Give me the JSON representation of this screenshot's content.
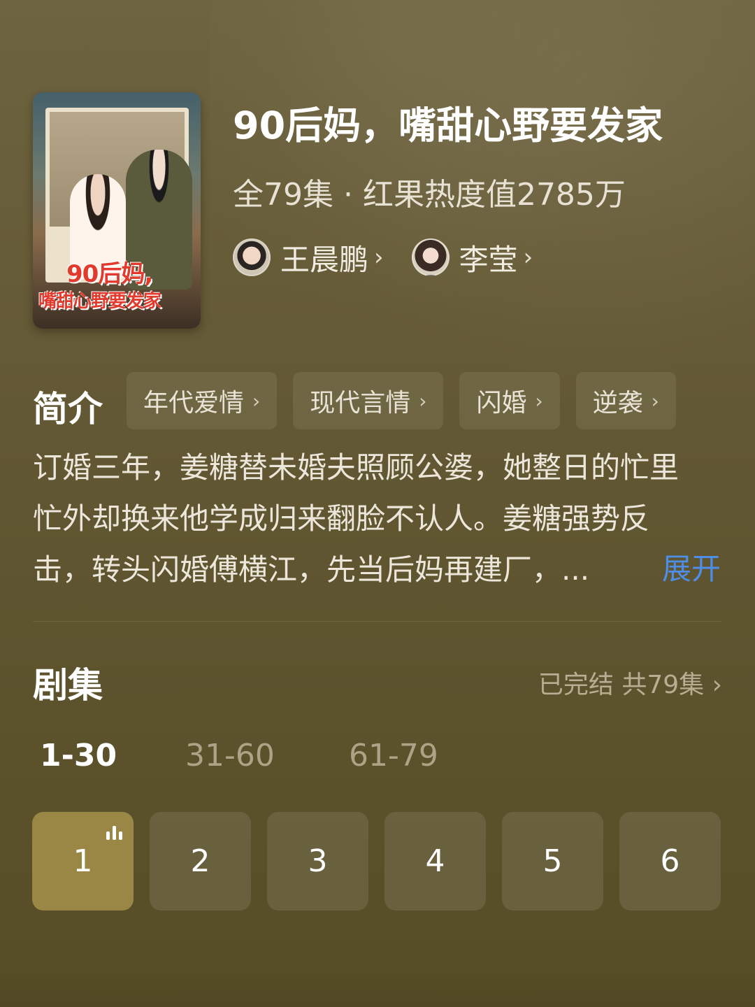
{
  "drama": {
    "poster_title_line1": "90后妈,",
    "poster_title_line2": "嘴甜心野要发家",
    "title": "90后妈，嘴甜心野要发家",
    "meta": "全79集 · 红果热度值2785万"
  },
  "cast": [
    {
      "name": "王晨鹏",
      "chevron": "›"
    },
    {
      "name": "李莹",
      "chevron": "›"
    }
  ],
  "intro": {
    "label": "简介",
    "tags": [
      {
        "label": "年代爱情",
        "chevron": "›"
      },
      {
        "label": "现代言情",
        "chevron": "›"
      },
      {
        "label": "闪婚",
        "chevron": "›"
      },
      {
        "label": "逆袭",
        "chevron": "›"
      }
    ],
    "description_lines": [
      "订婚三年，姜糖替未婚夫照顾公婆，她整日的忙里",
      "忙外却换来他学成归来翻脸不认人。姜糖强势反",
      "击，转头闪婚傅横江，先当后妈再建厂，..."
    ],
    "expand_label": "展开"
  },
  "episodes": {
    "label": "剧集",
    "status": "已完结 共79集 ›",
    "ranges": [
      "1-30",
      "31-60",
      "61-79"
    ],
    "selected_range": "1-30",
    "items": [
      "1",
      "2",
      "3",
      "4",
      "5",
      "6"
    ],
    "current": "1"
  },
  "colors": {
    "accent_blue": "#4f8ee6",
    "active_episode": "#9a8745"
  }
}
